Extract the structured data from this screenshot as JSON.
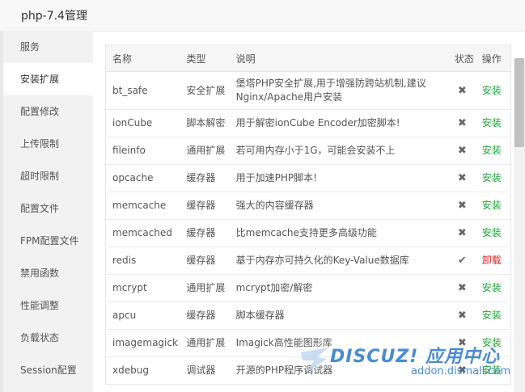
{
  "dialog": {
    "title": "php-7.4管理"
  },
  "sidebar": {
    "items": [
      {
        "label": "服务",
        "active": false
      },
      {
        "label": "安装扩展",
        "active": true
      },
      {
        "label": "配置修改",
        "active": false
      },
      {
        "label": "上传限制",
        "active": false
      },
      {
        "label": "超时限制",
        "active": false
      },
      {
        "label": "配置文件",
        "active": false
      },
      {
        "label": "FPM配置文件",
        "active": false
      },
      {
        "label": "禁用函数",
        "active": false
      },
      {
        "label": "性能调整",
        "active": false
      },
      {
        "label": "负载状态",
        "active": false
      },
      {
        "label": "Session配置",
        "active": false
      }
    ]
  },
  "table": {
    "headers": {
      "name": "名称",
      "type": "类型",
      "desc": "说明",
      "state": "状态",
      "op": "操作"
    },
    "rows": [
      {
        "name": "bt_safe",
        "type": "安全扩展",
        "desc": "堡塔PHP安全扩展,用于增强防跨站机制,建议Nginx/Apache用户安装",
        "installed": false,
        "op": "安装"
      },
      {
        "name": "ionCube",
        "type": "脚本解密",
        "desc": "用于解密ionCube Encoder加密脚本!",
        "installed": false,
        "op": "安装"
      },
      {
        "name": "fileinfo",
        "type": "通用扩展",
        "desc": "若可用内存小于1G，可能会安装不上",
        "installed": false,
        "op": "安装"
      },
      {
        "name": "opcache",
        "type": "缓存器",
        "desc": "用于加速PHP脚本!",
        "installed": false,
        "op": "安装"
      },
      {
        "name": "memcache",
        "type": "缓存器",
        "desc": "强大的内容缓存器",
        "installed": false,
        "op": "安装"
      },
      {
        "name": "memcached",
        "type": "缓存器",
        "desc": "比memcache支持更多高级功能",
        "installed": false,
        "op": "安装"
      },
      {
        "name": "redis",
        "type": "缓存器",
        "desc": "基于内存亦可持久化的Key-Value数据库",
        "installed": true,
        "op": "卸载"
      },
      {
        "name": "mcrypt",
        "type": "通用扩展",
        "desc": "mcrypt加密/解密",
        "installed": false,
        "op": "安装"
      },
      {
        "name": "apcu",
        "type": "缓存器",
        "desc": "脚本缓存器",
        "installed": false,
        "op": "安装"
      },
      {
        "name": "imagemagick",
        "type": "通用扩展",
        "desc": "Imagick高性能图形库",
        "installed": false,
        "op": "安装"
      },
      {
        "name": "xdebug",
        "type": "调试器",
        "desc": "开源的PHP程序调试器",
        "installed": false,
        "op": "安装"
      }
    ]
  },
  "icons": {
    "not_installed": "close-x-icon",
    "installed": "check-icon"
  },
  "colors": {
    "install": "#20a53a",
    "uninstall": "#e02020",
    "watermark": "#2b77c8"
  },
  "watermark": {
    "brand": "DISCUZ! 应用中心",
    "url": "addon.dismall.com"
  }
}
